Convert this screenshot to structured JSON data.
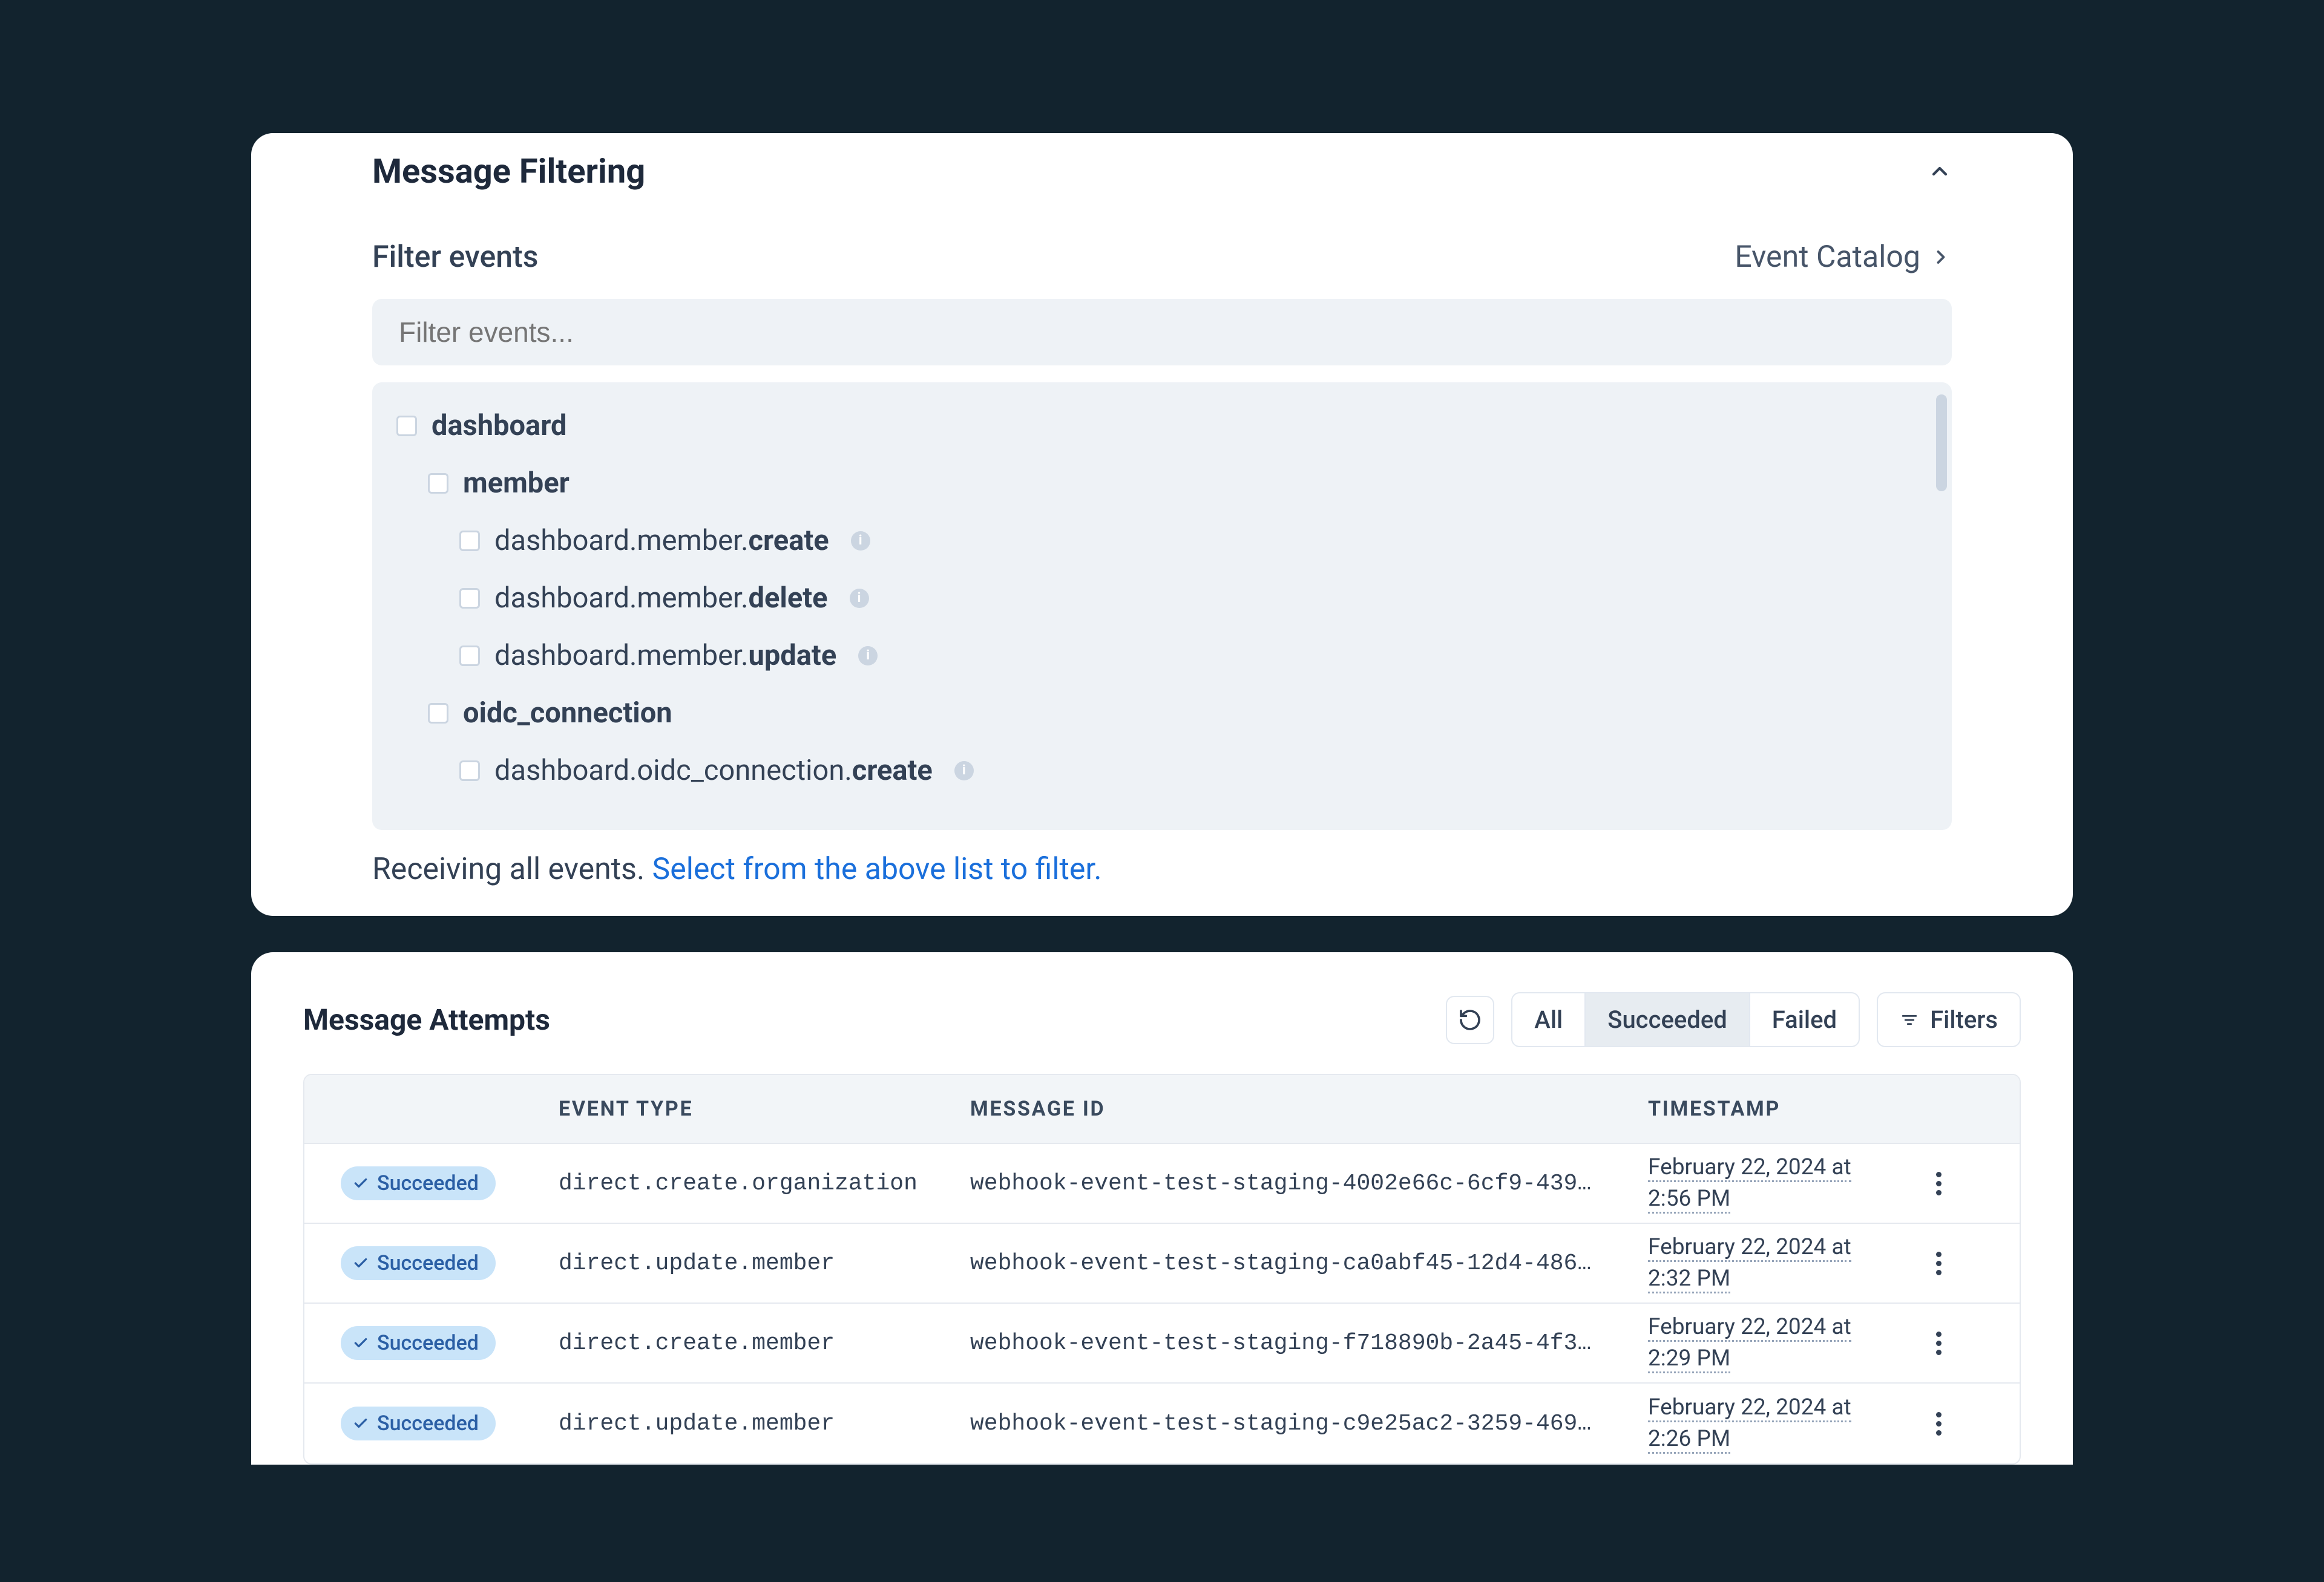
{
  "filtering": {
    "title": "Message Filtering",
    "subheader": "Filter events",
    "catalog_link": "Event Catalog",
    "search_placeholder": "Filter events...",
    "tree": {
      "root_group": "dashboard",
      "groups": [
        {
          "label": "member",
          "items": [
            {
              "prefix": "dashboard.member.",
              "suffix": "create"
            },
            {
              "prefix": "dashboard.member.",
              "suffix": "delete"
            },
            {
              "prefix": "dashboard.member.",
              "suffix": "update"
            }
          ]
        },
        {
          "label": "oidc_connection",
          "items": [
            {
              "prefix": "dashboard.oidc_connection.",
              "suffix": "create"
            }
          ]
        }
      ]
    },
    "receiving": {
      "text": "Receiving all events. ",
      "link": "Select from the above list to filter."
    }
  },
  "attempts": {
    "title": "Message Attempts",
    "tabs": {
      "all": "All",
      "succeeded": "Succeeded",
      "failed": "Failed",
      "active": "succeeded"
    },
    "filters_button": "Filters",
    "columns": {
      "status": "",
      "event_type": "EVENT TYPE",
      "message_id": "MESSAGE ID",
      "timestamp": "TIMESTAMP"
    },
    "status_label": "Succeeded",
    "rows": [
      {
        "event_type": "direct.create.organization",
        "message_id": "webhook-event-test-staging-4002e66c-6cf9-439…",
        "timestamp": "February 22, 2024 at 2:56 PM"
      },
      {
        "event_type": "direct.update.member",
        "message_id": "webhook-event-test-staging-ca0abf45-12d4-486…",
        "timestamp": "February 22, 2024 at 2:32 PM"
      },
      {
        "event_type": "direct.create.member",
        "message_id": "webhook-event-test-staging-f718890b-2a45-4f3…",
        "timestamp": "February 22, 2024 at 2:29 PM"
      },
      {
        "event_type": "direct.update.member",
        "message_id": "webhook-event-test-staging-c9e25ac2-3259-469…",
        "timestamp": "February 22, 2024 at 2:26 PM"
      }
    ]
  }
}
